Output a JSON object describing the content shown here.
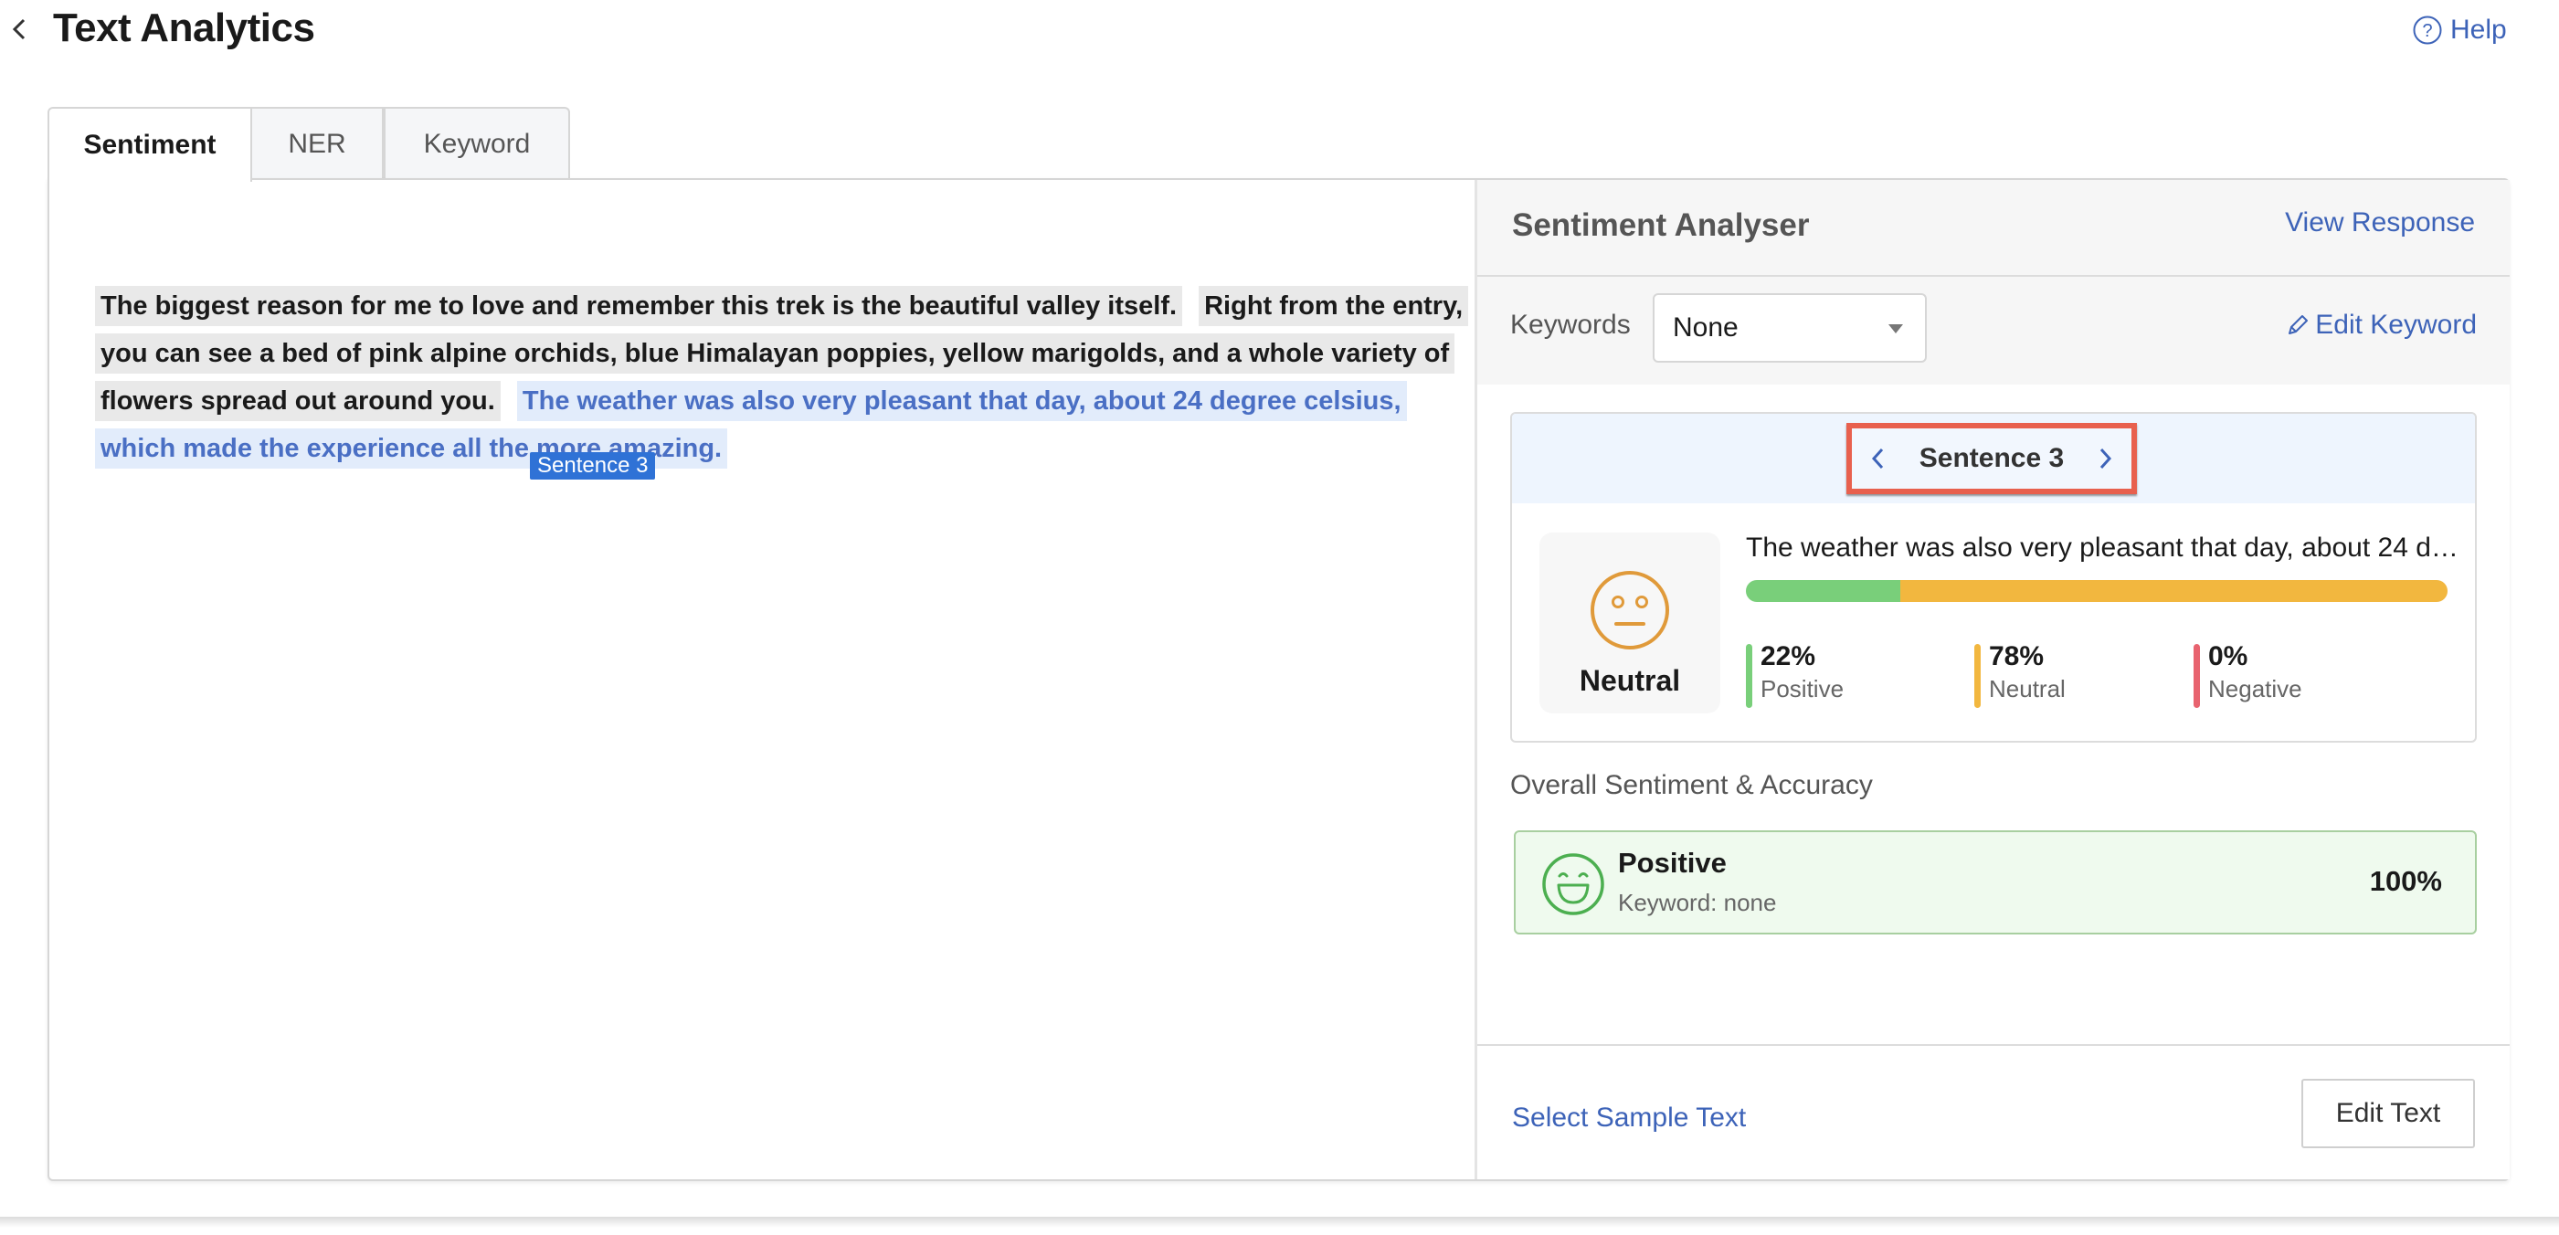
{
  "header": {
    "title": "Text Analytics",
    "help_label": "Help",
    "back_icon": "chevron-left-icon",
    "help_icon": "question-circle-icon"
  },
  "tabs": [
    {
      "label": "Sentiment",
      "active": true
    },
    {
      "label": "NER",
      "active": false
    },
    {
      "label": "Keyword",
      "active": false
    }
  ],
  "text_area": {
    "sentences": [
      {
        "index": 1,
        "text": "The biggest reason for me to love and remember this trek is the beautiful valley itself.",
        "highlighted": false
      },
      {
        "index": 2,
        "text": "Right from the entry, you can see a bed of pink alpine orchids, blue Himalayan poppies, yellow marigolds, and a whole variety of flowers spread out around you.",
        "highlighted": false
      },
      {
        "index": 3,
        "text": "The weather was also very pleasant that day, about 24 degree celsius, which made the experience all the more amazing.",
        "highlighted": true
      }
    ],
    "tooltip": "Sentence 3"
  },
  "analyser": {
    "title": "Sentiment Analyser",
    "view_response_label": "View Response",
    "keywords_label": "Keywords",
    "keywords_selected": "None",
    "edit_keyword_label": "Edit Keyword",
    "sentence_card": {
      "nav_label": "Sentence 3",
      "sentiment_label": "Neutral",
      "sentiment_icon": "neutral-face-icon",
      "snippet": "The weather was also very pleasant that day, about 24 de...",
      "scores": [
        {
          "label": "Positive",
          "value": 22,
          "display": "22%",
          "color": "#79cf7a"
        },
        {
          "label": "Neutral",
          "value": 78,
          "display": "78%",
          "color": "#f2b73f"
        },
        {
          "label": "Negative",
          "value": 0,
          "display": "0%",
          "color": "#e8636f"
        }
      ]
    },
    "overall": {
      "section_label": "Overall Sentiment & Accuracy",
      "sentiment": "Positive",
      "keyword_text": "Keyword: none",
      "accuracy": "100%",
      "icon": "grinning-face-icon"
    },
    "footer": {
      "sample_text_label": "Select Sample Text",
      "edit_text_label": "Edit Text"
    }
  },
  "colors": {
    "accent": "#3d63b8",
    "highlight_bg": "#e2ecfb",
    "highlight_text": "#4a6fc4",
    "tooltip_bg": "#2f72d6",
    "nav_outline": "#e8604e",
    "positive": "#79cf7a",
    "neutral": "#f2b73f",
    "negative": "#e8636f"
  }
}
